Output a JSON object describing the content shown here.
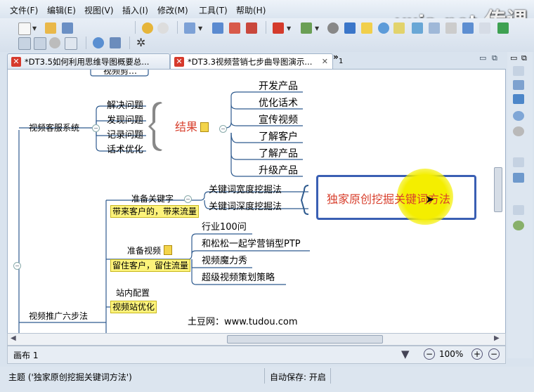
{
  "menubar": {
    "items": [
      "文件(F)",
      "编辑(E)",
      "视图(V)",
      "插入(I)",
      "修改(M)",
      "工具(T)",
      "帮助(H)"
    ],
    "watermark_text": "vxia.net",
    "watermark_cn": "传课"
  },
  "tabs": [
    {
      "label": "*DT3.5如何利用思维导图概要总...",
      "close": ""
    },
    {
      "label": "*DT3.3视频营销七步曲导图演示...",
      "close": "✕"
    },
    {
      "label": "1",
      "overflow_glyph": "»"
    }
  ],
  "mindmap": {
    "top_partial": "视频剪…",
    "customer_service": {
      "label": "视频客服系统",
      "children": [
        "解决问题",
        "发现问题",
        "记录问题",
        "话术优化"
      ]
    },
    "result": {
      "label": "结果",
      "children": [
        "开发产品",
        "优化话术",
        "宣传视频",
        "了解客户",
        "了解产品",
        "升级产品"
      ]
    },
    "keyword_prep": {
      "label": "准备关键字",
      "note": "带来客户的，带来流量",
      "children": [
        "关键词宽度挖掘法",
        "关键词深度挖掘法"
      ]
    },
    "callout": "独家原创挖掘关键词方法",
    "video_prep": {
      "label": "准备视频",
      "note": "留住客户，留住流量",
      "children": [
        "行业100问",
        "和松松一起学营销型PTP",
        "视频魔力秀",
        "超级视频策划策略"
      ]
    },
    "site_config": {
      "label": "站内配置",
      "note": "视频站优化"
    },
    "promotion": {
      "label": "视频推广六步法"
    },
    "tudou": "土豆网：www.tudou.com"
  },
  "zoombar": {
    "sheet_label": "画布 1",
    "zoom": "100%",
    "zoom_in": "+",
    "zoom_out": "−"
  },
  "statusbar": {
    "topic": "主题 ('独家原创挖掘关键词方法')",
    "autosave": "自动保存: 开启"
  },
  "colors": {
    "accent_red": "#d8402e",
    "callout_border": "#3a5fb3",
    "highlight": "#fdf37b",
    "cursor_glow": "#f4ee00",
    "line_blue": "#2f5b8f"
  }
}
